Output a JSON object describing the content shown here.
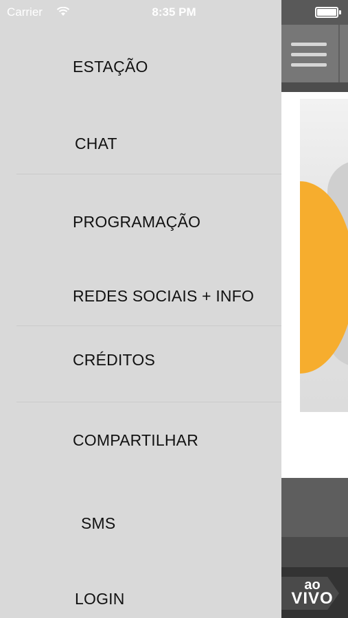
{
  "status_bar": {
    "carrier": "Carrier",
    "time": "8:35 PM"
  },
  "menu": {
    "items": [
      {
        "label": "ESTAÇÃO"
      },
      {
        "label": "CHAT"
      },
      {
        "label": "PROGRAMAÇÃO"
      },
      {
        "label": "REDES SOCIAIS + INFO"
      },
      {
        "label": "CRÉDITOS"
      },
      {
        "label": "COMPARTILHAR"
      },
      {
        "label": "SMS"
      },
      {
        "label": "LOGIN"
      }
    ]
  },
  "live_button": {
    "line1": "ao",
    "line2": "VIVO"
  },
  "colors": {
    "drawer_bg": "#d9d9d9",
    "accent_orange": "#f6ad2e",
    "nav_gray": "#777777"
  }
}
